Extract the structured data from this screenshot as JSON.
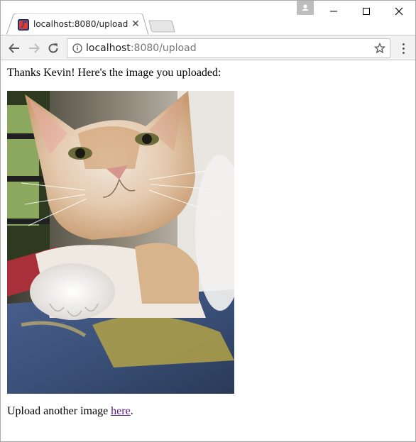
{
  "tab": {
    "title": "localhost:8080/upload",
    "close_glyph": "✕",
    "favicon": "java-icon"
  },
  "toolbar": {
    "url_host": "localhost",
    "url_path": ":8080/upload"
  },
  "page": {
    "thanks_text": "Thanks Kevin! Here's the image you uploaded:",
    "image_subject": "orange-and-white-cat-photo",
    "again_prefix": "Upload another image ",
    "again_link": "here",
    "again_suffix": "."
  },
  "colors": {
    "link_visited": "#551a8b",
    "toolbar_bg": "#f2f2f2"
  }
}
